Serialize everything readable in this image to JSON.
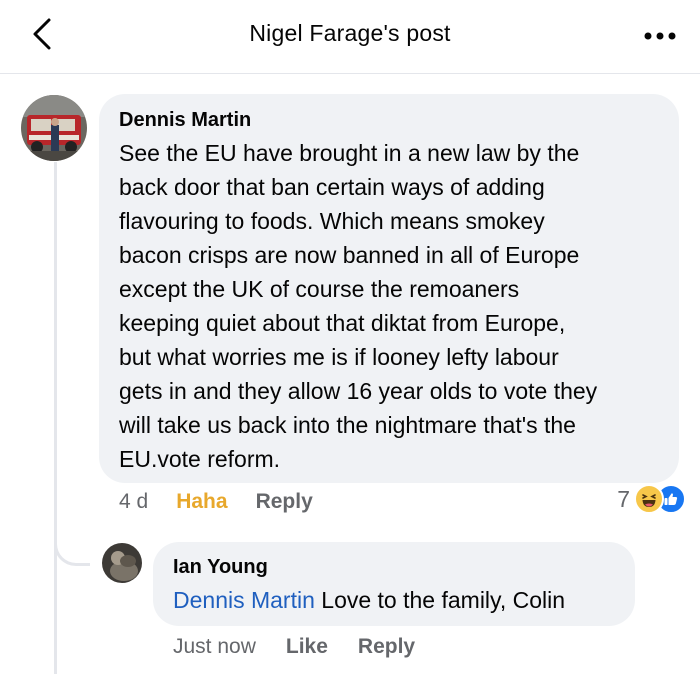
{
  "header": {
    "title": "Nigel Farage's post",
    "back_icon": "chevron-left-icon",
    "more_icon": "more-horizontal-icon"
  },
  "comment": {
    "author": "Dennis Martin",
    "text": "See the EU have brought in a new law by the\nback door that ban certain ways of adding\nflavouring to foods. Which means smokey\nbacon crisps are now banned in all of Europe\nexcept the UK of course the remoaners\nkeeping quiet about that diktat from Europe,\nbut what worries me is if looney lefty labour\ngets in and they allow 16 year olds to vote they\nwill take us back into the nightmare that's the\nEU.vote reform.",
    "timestamp": "4 d",
    "reaction_label": "Haha",
    "reply_label": "Reply",
    "reaction_count": "7",
    "reaction_icons": [
      "haha-icon",
      "like-icon"
    ]
  },
  "reply": {
    "author": "Ian Young",
    "mention": "Dennis Martin",
    "text": " Love to the family, Colin",
    "timestamp": "Just now",
    "like_label": "Like",
    "reply_label": "Reply"
  },
  "colors": {
    "bubble": "#f0f2f5",
    "secondary_text": "#65676b",
    "mention": "#1f5fbf",
    "haha": "#e8a82c",
    "like_blue": "#1877f2"
  }
}
